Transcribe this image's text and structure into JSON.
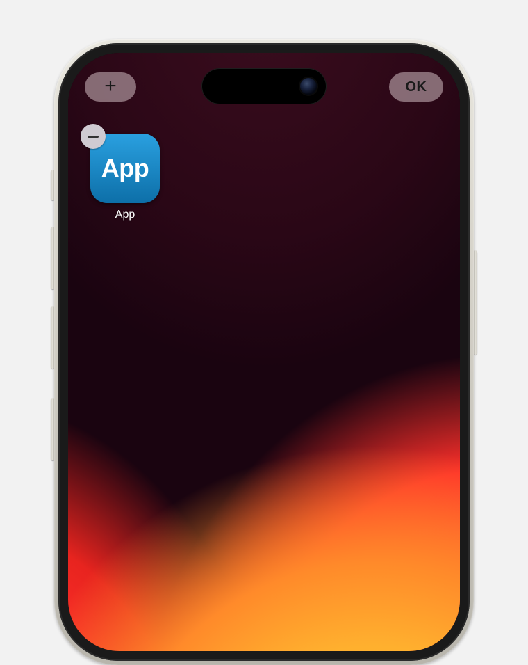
{
  "toolbar": {
    "add_label": "+",
    "done_label": "OK"
  },
  "apps": [
    {
      "icon_text": "App",
      "label": "App",
      "icon_bg_top": "#2aa0e0",
      "icon_bg_bottom": "#0d6fa8"
    }
  ],
  "icons": {
    "remove_badge": "minus-icon",
    "add_button": "plus-icon"
  }
}
